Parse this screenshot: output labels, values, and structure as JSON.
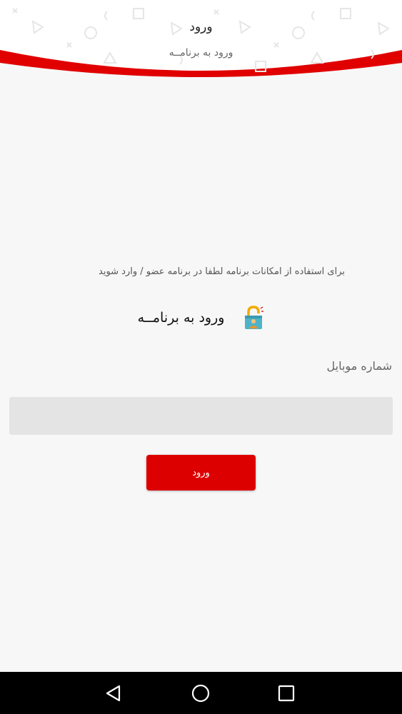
{
  "header": {
    "title": "ورود",
    "subtitle": "ورود به برنامــه"
  },
  "main": {
    "info_text": "برای استفاده از امکانات برنامه لطفا در برنامه عضو / وارد شوید",
    "login_heading": "ورود به برنامــه",
    "lock_icon": "lock-icon",
    "phone_label": "شماره موبایل",
    "phone_value": "",
    "phone_placeholder": "",
    "login_button": "ورود"
  },
  "navbar": {
    "back_icon": "back-triangle-icon",
    "home_icon": "home-circle-icon",
    "recents_icon": "recents-square-icon"
  },
  "colors": {
    "accent": "#dd0000",
    "background": "#f7f7f7",
    "input_bg": "#e4e4e4",
    "navbar": "#000000"
  }
}
